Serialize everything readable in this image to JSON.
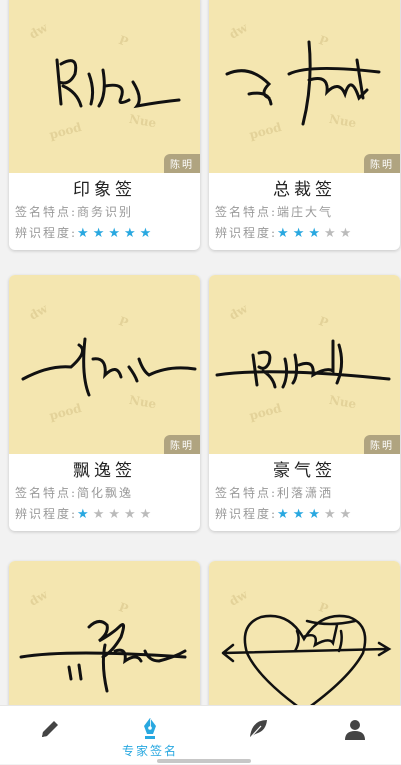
{
  "cards": [
    {
      "name": "印象签",
      "feature_label": "签名特点:",
      "feature": "商务识别",
      "rating_label": "辨识程度:",
      "rating": 5,
      "max": 5,
      "stamp": "陈明"
    },
    {
      "name": "总裁签",
      "feature_label": "签名特点:",
      "feature": "端庄大气",
      "rating_label": "辨识程度:",
      "rating": 3,
      "max": 5,
      "stamp": "陈明"
    },
    {
      "name": "飘逸签",
      "feature_label": "签名特点:",
      "feature": "简化飘逸",
      "rating_label": "辨识程度:",
      "rating": 1,
      "max": 5,
      "stamp": "陈明"
    },
    {
      "name": "豪气签",
      "feature_label": "签名特点:",
      "feature": "利落潇洒",
      "rating_label": "辨识程度:",
      "rating": 3,
      "max": 5,
      "stamp": "陈明"
    },
    {
      "name": "",
      "feature_label": "",
      "feature": "",
      "rating_label": "",
      "rating": 0,
      "max": 5,
      "stamp": ""
    },
    {
      "name": "",
      "feature_label": "",
      "feature": "",
      "rating_label": "",
      "rating": 0,
      "max": 5,
      "stamp": ""
    }
  ],
  "tabbar": {
    "tabs": [
      {
        "icon": "pencil-icon",
        "label": "",
        "active": false
      },
      {
        "icon": "fountain-pen-icon",
        "label": "专家签名",
        "active": true
      },
      {
        "icon": "feather-icon",
        "label": "",
        "active": false
      },
      {
        "icon": "user-icon",
        "label": "",
        "active": false
      }
    ]
  },
  "colors": {
    "accent": "#29a8e0",
    "paper": "#f4e6b0",
    "star_off": "#bbbbbb"
  }
}
